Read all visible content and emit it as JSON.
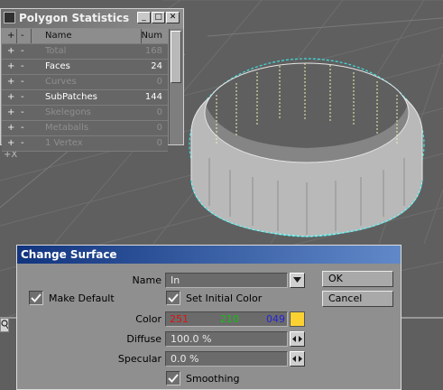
{
  "polygon_statistics": {
    "title": "Polygon Statistics",
    "headers": {
      "plus": "+",
      "dash": "-",
      "name": "Name",
      "num": "Num"
    },
    "rows": [
      {
        "plus": "+",
        "dash": "-",
        "name": "Total",
        "num": "168"
      },
      {
        "plus": "+",
        "dash": "-",
        "name": "Faces",
        "num": "24"
      },
      {
        "plus": "+",
        "dash": "-",
        "name": "Curves",
        "num": "0"
      },
      {
        "plus": "+",
        "dash": "-",
        "name": "SubPatches",
        "num": "144"
      },
      {
        "plus": "+",
        "dash": "-",
        "name": "Skelegons",
        "num": "0"
      },
      {
        "plus": "+",
        "dash": "-",
        "name": "Metaballs",
        "num": "0"
      },
      {
        "plus": "+",
        "dash": "-",
        "name": "1 Vertex",
        "num": "0"
      }
    ]
  },
  "viewport": {
    "axis_label": "+X"
  },
  "change_surface": {
    "title": "Change Surface",
    "name_label": "Name",
    "name_value": "In",
    "make_default_label": "Make Default",
    "set_initial_color_label": "Set Initial Color",
    "color_label": "Color",
    "color_r": "251",
    "color_g": "210",
    "color_b": "049",
    "color_swatch": "#fbd231",
    "diffuse_label": "Diffuse",
    "diffuse_value": "100.0 %",
    "specular_label": "Specular",
    "specular_value": "0.0 %",
    "smoothing_label": "Smoothing",
    "ok_label": "OK",
    "cancel_label": "Cancel"
  }
}
